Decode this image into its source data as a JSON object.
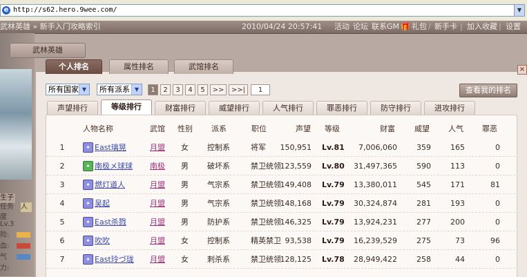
{
  "browser": {
    "url": "http://s62.hero.9wee.com/"
  },
  "topbar": {
    "title": "武林英雄 » 新手入门攻略索引",
    "datetime": "2010/04/24 20:57:41",
    "links": [
      "活动",
      "论坛",
      "联系GM",
      "礼包",
      "新手卡",
      "加入收藏",
      "设置"
    ]
  },
  "left": {
    "char_name": "武林英雄",
    "portrait_tag": "生子",
    "side_labels": [
      "任务",
      "人",
      "度",
      "Lv.3",
      "险:",
      "血:",
      "气",
      "力:"
    ]
  },
  "main_tabs": [
    {
      "label": "个人排名",
      "active": true
    },
    {
      "label": "属性排名",
      "active": false
    },
    {
      "label": "武馆排名",
      "active": false
    }
  ],
  "filters": {
    "country": "所有国家",
    "faction": "所有派系"
  },
  "pager": {
    "pages": [
      "1",
      "2",
      "3",
      "4",
      "5",
      ">>",
      ">>|"
    ],
    "current": "1",
    "input": "1"
  },
  "my_rank_button": "查看我的排名",
  "rank_tabs": [
    {
      "label": "声望排行",
      "active": false
    },
    {
      "label": "等级排行",
      "active": true
    },
    {
      "label": "财富排行",
      "active": false
    },
    {
      "label": "威望排行",
      "active": false
    },
    {
      "label": "人气排行",
      "active": false
    },
    {
      "label": "罪恶排行",
      "active": false
    },
    {
      "label": "防守排行",
      "active": false
    },
    {
      "label": "进攻排行",
      "active": false
    }
  ],
  "table": {
    "headers": [
      "人物名称",
      "武馆",
      "性别",
      "派系",
      "职位",
      "声望",
      "等级",
      "财富",
      "威望",
      "人气",
      "罪恶"
    ],
    "rows": [
      {
        "rank": "1",
        "icon": "purple",
        "name": "East璃晃",
        "guild": "月盟",
        "sex": "女",
        "sect": "控制系",
        "post": "将军",
        "prestige": "150,951",
        "level": "Lv.81",
        "wealth": "7,006,060",
        "might": "359",
        "pop": "165",
        "evil": "0"
      },
      {
        "rank": "2",
        "icon": "green",
        "name": "南极メ球球",
        "guild": "南极",
        "sex": "男",
        "sect": "破坏系",
        "post": "禁卫统领",
        "prestige": "123,559",
        "level": "Lv.80",
        "wealth": "31,497,365",
        "might": "590",
        "pop": "113",
        "evil": "0"
      },
      {
        "rank": "3",
        "icon": "purple",
        "name": "燃灯道人",
        "guild": "月盟",
        "sex": "男",
        "sect": "气宗系",
        "post": "禁卫统领",
        "prestige": "149,408",
        "level": "Lv.79",
        "wealth": "13,380,011",
        "might": "545",
        "pop": "171",
        "evil": "81"
      },
      {
        "rank": "4",
        "icon": "purple",
        "name": "吴起",
        "guild": "月盟",
        "sex": "男",
        "sect": "气宗系",
        "post": "禁卫统领",
        "prestige": "148,168",
        "level": "Lv.79",
        "wealth": "30,324,874",
        "might": "281",
        "pop": "193",
        "evil": "0"
      },
      {
        "rank": "5",
        "icon": "purple",
        "name": "East杀戮",
        "guild": "月盟",
        "sex": "男",
        "sect": "防护系",
        "post": "禁卫统领",
        "prestige": "146,325",
        "level": "Lv.79",
        "wealth": "13,924,231",
        "might": "277",
        "pop": "200",
        "evil": "0"
      },
      {
        "rank": "6",
        "icon": "purple",
        "name": "吹吹",
        "guild": "月盟",
        "sex": "女",
        "sect": "控制系",
        "post": "精英禁卫",
        "prestige": "93,538",
        "level": "Lv.79",
        "wealth": "16,239,529",
        "might": "275",
        "pop": "73",
        "evil": "96"
      },
      {
        "rank": "7",
        "icon": "purple",
        "name": "East玲づ珑",
        "guild": "月盟",
        "sex": "女",
        "sect": "刺杀系",
        "post": "禁卫统领",
        "prestige": "128,125",
        "level": "Lv.78",
        "wealth": "28,949,422",
        "might": "258",
        "pop": "44",
        "evil": "0"
      }
    ]
  },
  "colors": {
    "accent_tab": "#7a5b52",
    "level_text": "#2c1a12",
    "name_link": "#3a47a8",
    "guild_link": "#a3327a"
  }
}
